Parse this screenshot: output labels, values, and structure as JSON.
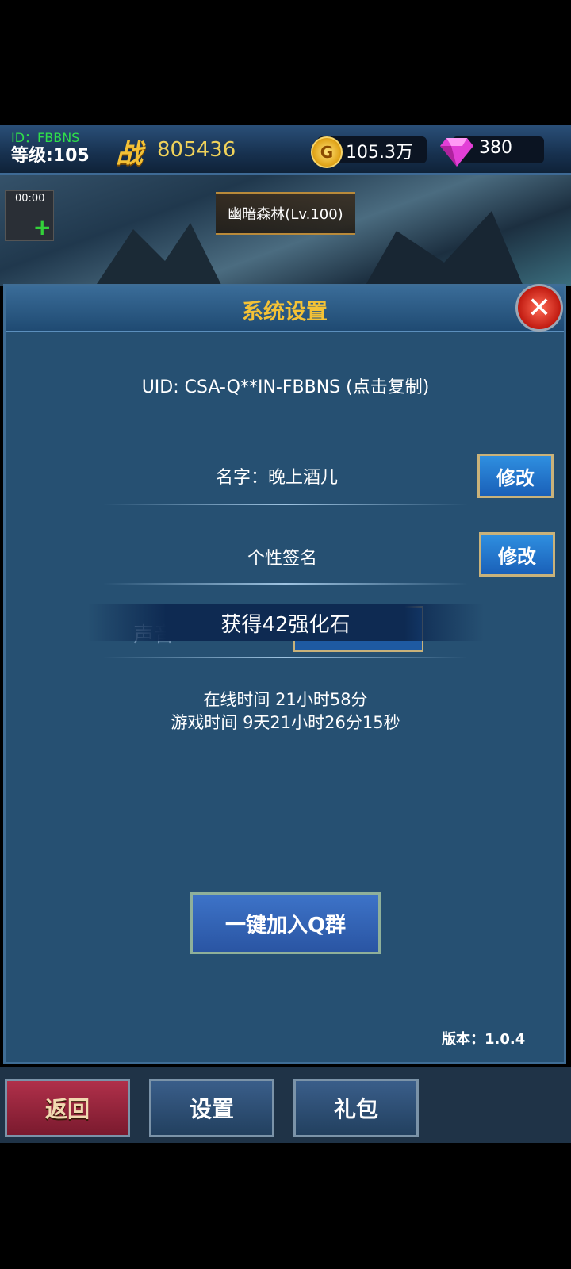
{
  "top": {
    "id_label": "ID：FBBNS",
    "level_label": "等级:105",
    "power_icon_text": "战",
    "power_value": "805436",
    "gold_icon_text": "G",
    "gold_value": "105.3万",
    "gem_value": "380"
  },
  "scene": {
    "timer": "00:00",
    "plus_icon": "+",
    "map_name": "幽暗森林(Lv.100)"
  },
  "panel": {
    "title": "系统设置",
    "close_icon": "✕",
    "uid_text": "UID: CSA-Q**IN-FBBNS (点击复制)",
    "name_label": "名字：晚上酒儿",
    "name_edit": "修改",
    "signature_label": "个性签名",
    "signature_edit": "修改",
    "sound_label": "声音",
    "toast": "获得42强化石",
    "online_time": "在线时间 21小时58分",
    "game_time": "游戏时间 9天21小时26分15秒",
    "qq_button": "一键加入Q群",
    "version": "版本：1.0.4"
  },
  "nav": {
    "back": "返回",
    "settings": "设置",
    "gift": "礼包"
  },
  "colors": {
    "gold_text": "#f4c236",
    "panel_bg": "#265072",
    "id_green": "#2fe04a"
  }
}
